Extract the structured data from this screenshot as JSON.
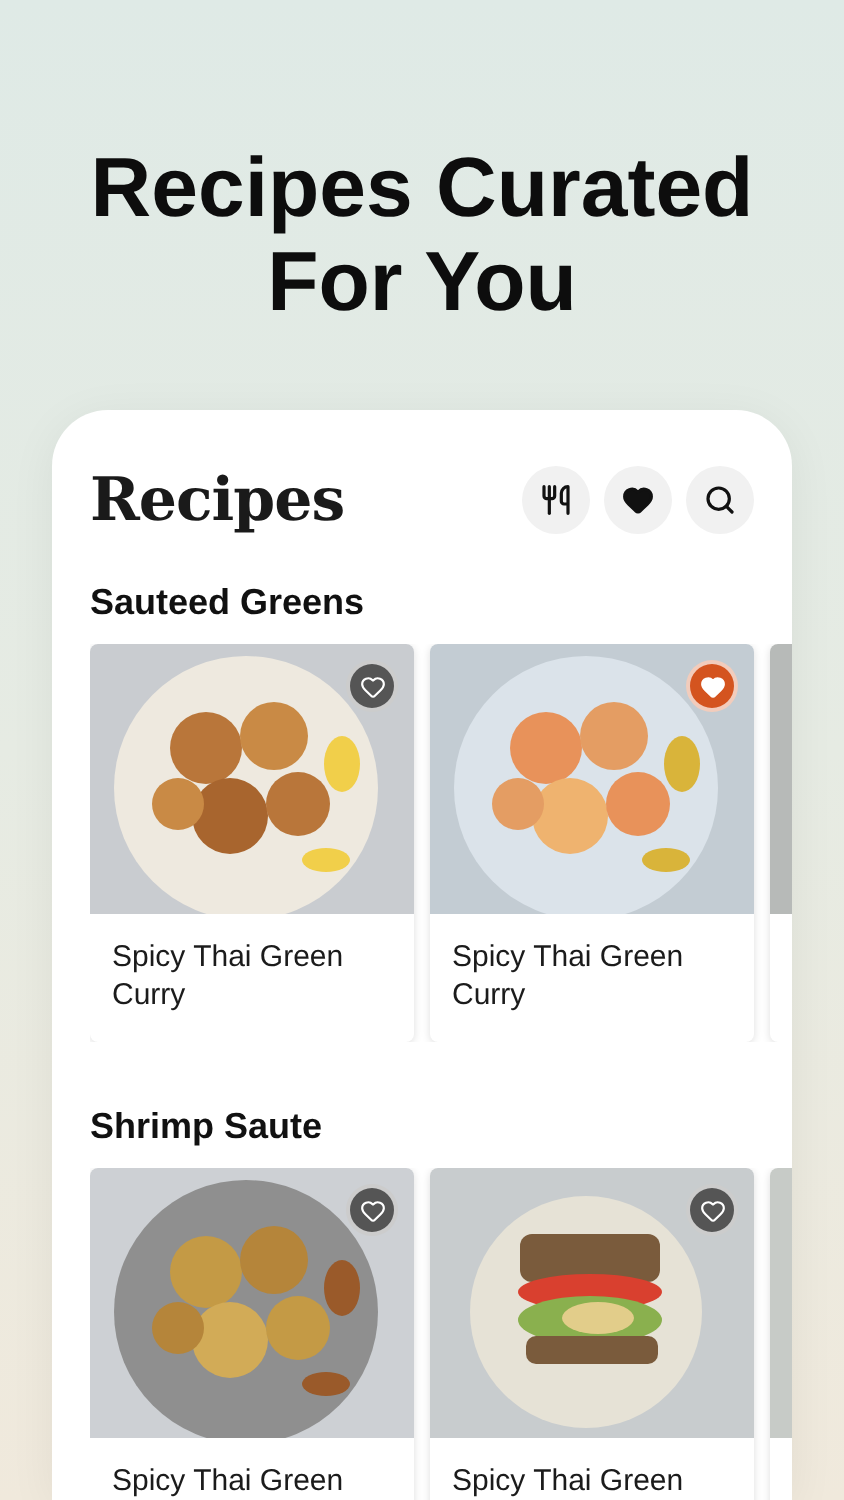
{
  "headline": "Recipes Curated For You",
  "screen": {
    "title": "Recipes",
    "toolbar": [
      {
        "kind": "utensils"
      },
      {
        "kind": "favorites"
      },
      {
        "kind": "search"
      }
    ],
    "sections": [
      {
        "title": "Sauteed Greens",
        "cards": [
          {
            "kind": "recipe",
            "title": "Spicy Thai Green Curry",
            "favorited": false
          },
          {
            "kind": "recipe",
            "title": "Spicy Thai Green Curry",
            "favorited": true
          },
          {
            "kind": "peek"
          }
        ]
      },
      {
        "title": "Shrimp Saute",
        "cards": [
          {
            "kind": "recipe",
            "title": "Spicy Thai Green",
            "favorited": false
          },
          {
            "kind": "recipe",
            "title": "Spicy Thai Green",
            "favorited": false
          },
          {
            "kind": "peek"
          }
        ]
      }
    ]
  }
}
